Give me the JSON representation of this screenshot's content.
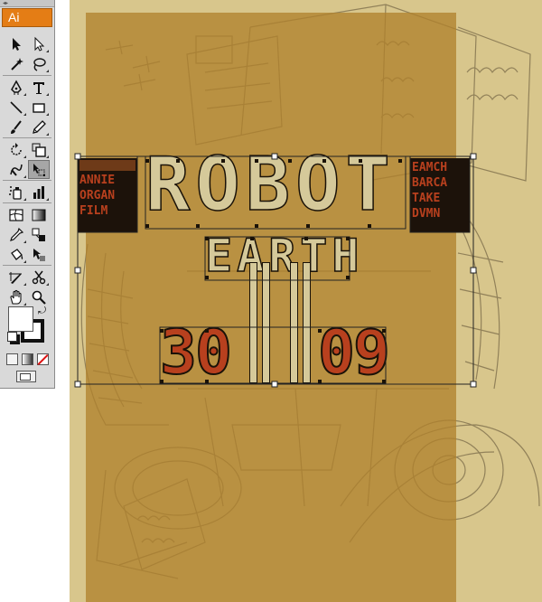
{
  "app": {
    "logo_text": "Ai",
    "brand_color": "#e47d15"
  },
  "toolbox": {
    "tools": [
      {
        "name": "selection-tool",
        "icon": "arrow-icon"
      },
      {
        "name": "direct-selection-tool",
        "icon": "hollow-arrow-icon"
      },
      {
        "name": "magic-wand-tool",
        "icon": "magic-wand-icon"
      },
      {
        "name": "lasso-tool",
        "icon": "lasso-icon"
      },
      {
        "name": "pen-tool",
        "icon": "pen-icon"
      },
      {
        "name": "type-tool",
        "icon": "type-icon",
        "glyph": "T"
      },
      {
        "name": "line-segment-tool",
        "icon": "line-icon"
      },
      {
        "name": "rectangle-tool",
        "icon": "rectangle-icon"
      },
      {
        "name": "paintbrush-tool",
        "icon": "paintbrush-icon"
      },
      {
        "name": "pencil-tool",
        "icon": "pencil-icon"
      },
      {
        "name": "rotate-tool",
        "icon": "rotate-icon"
      },
      {
        "name": "scale-tool",
        "icon": "scale-icon"
      },
      {
        "name": "warp-tool",
        "icon": "warp-icon"
      },
      {
        "name": "free-transform-tool",
        "icon": "free-transform-icon",
        "active": true
      },
      {
        "name": "symbol-sprayer-tool",
        "icon": "symbol-sprayer-icon"
      },
      {
        "name": "column-graph-tool",
        "icon": "column-graph-icon"
      },
      {
        "name": "mesh-tool",
        "icon": "mesh-icon"
      },
      {
        "name": "gradient-tool",
        "icon": "gradient-icon"
      },
      {
        "name": "eyedropper-tool",
        "icon": "eyedropper-icon"
      },
      {
        "name": "live-paint-bucket-tool",
        "icon": "paint-bucket-icon"
      },
      {
        "name": "slice-tool",
        "icon": "slice-icon"
      },
      {
        "name": "scissors-tool",
        "icon": "scissors-icon"
      },
      {
        "name": "hand-tool",
        "icon": "hand-icon"
      },
      {
        "name": "zoom-tool",
        "icon": "zoom-icon"
      }
    ],
    "fill_color": "#ffffff",
    "stroke_color": "#111111"
  },
  "poster": {
    "title_line1": "ROBOT",
    "title_line2": "EARTH",
    "date_left": "30",
    "date_right": "09",
    "side_left": [
      "ANNIE",
      "ORGAN",
      "FILM"
    ],
    "side_right": [
      "EAMCH",
      "BARCA",
      "TAKE",
      "DVMN"
    ],
    "title_color": "#d5c99a",
    "accent_color": "#b8401e",
    "poster_color": "#af822d",
    "paper_color": "#d8c68c"
  }
}
